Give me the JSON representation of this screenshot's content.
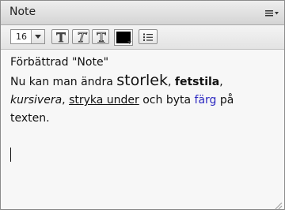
{
  "window": {
    "title": "Note"
  },
  "toolbar": {
    "font_size": "16",
    "bold_glyph": "T",
    "italic_glyph": "T",
    "underline_glyph": "T",
    "text_color": "#000000"
  },
  "note": {
    "heading": "Förbättrad \"Note\"",
    "line_intro": "Nu kan man ändra ",
    "word_size": "storlek",
    "comma1": ", ",
    "word_bold": "fetstila",
    "comma2": ",",
    "word_italic": "kursivera",
    "comma3": ", ",
    "word_strike": "stryka under",
    "mid": " och byta ",
    "word_color": "färg",
    "end": " på texten."
  },
  "colors": {
    "accent_text": "#2b27c0"
  }
}
